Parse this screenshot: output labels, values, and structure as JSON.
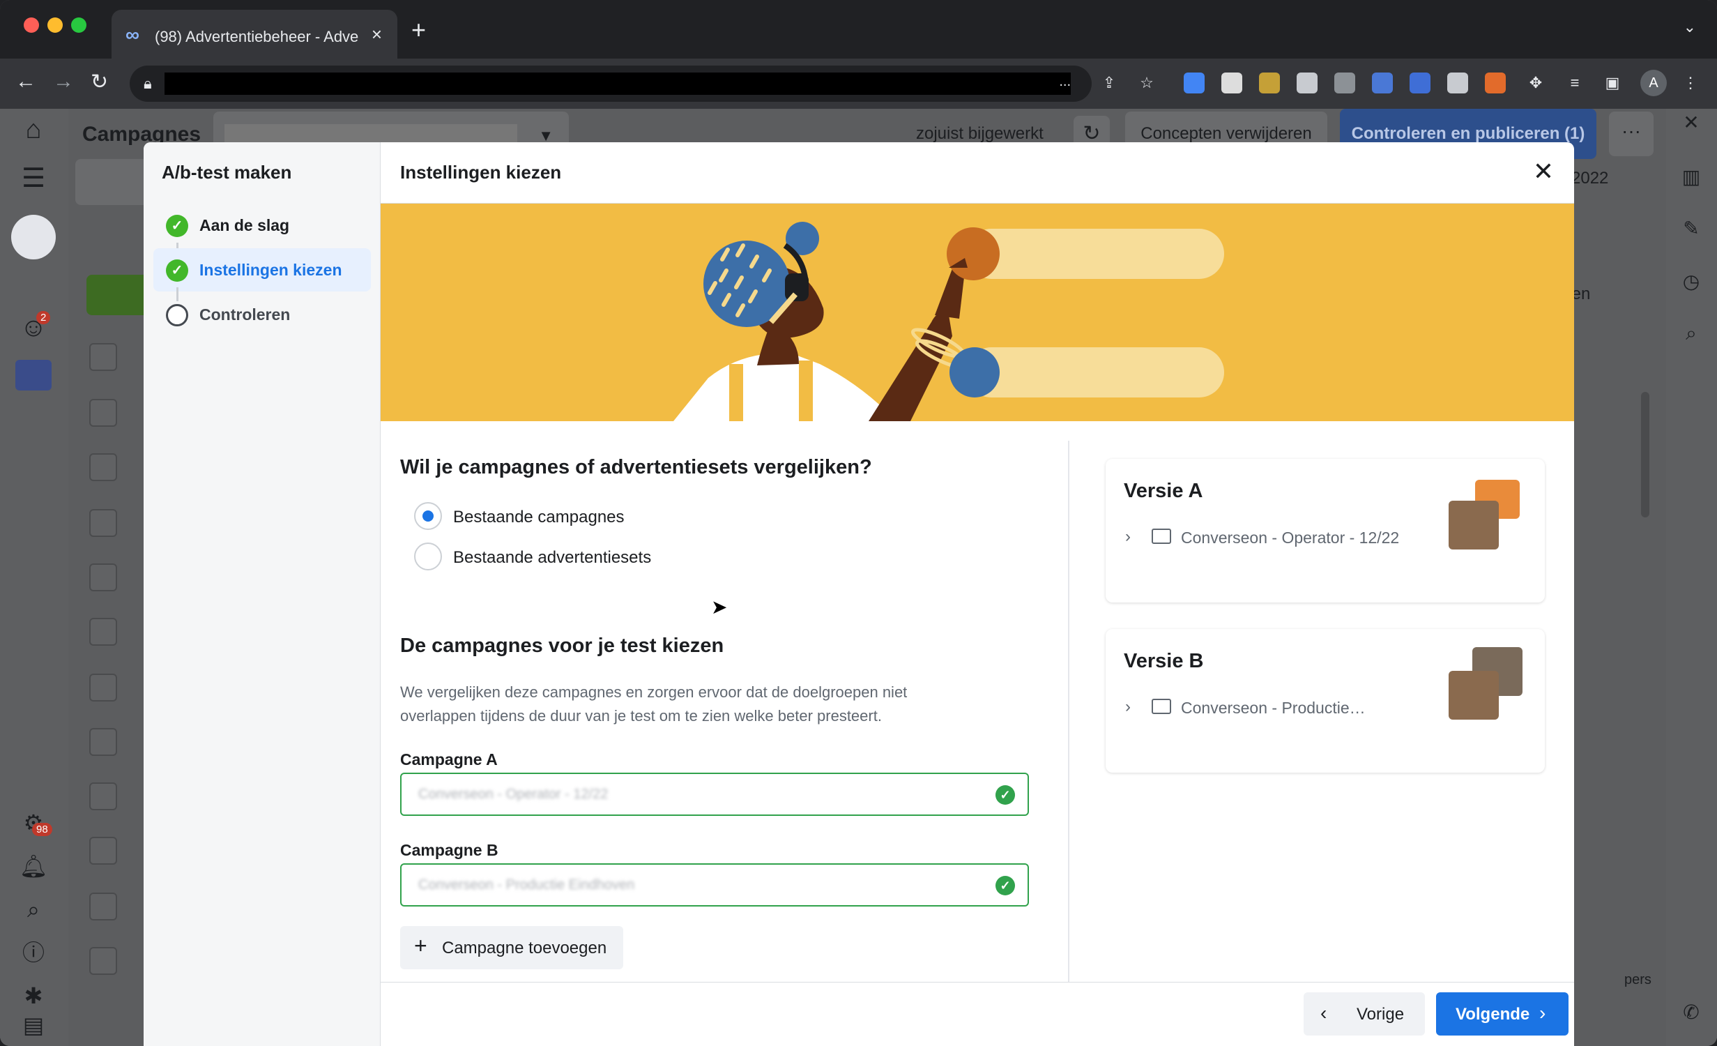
{
  "browser": {
    "tab_title": "(98) Advertentiebeheer - Adve",
    "close_tab": "×",
    "new_tab": "+",
    "url_ellipsis": "...",
    "profile_initial": "A"
  },
  "app": {
    "page_title": "Campagnes",
    "status_text": "zojuist bijgewerkt",
    "delete_drafts": "Concepten verwijderen",
    "review_publish": "Controleren en publiceren (1)",
    "more": "···",
    "year_partial": "2022",
    "export_partial": "rten",
    "columns_partial": "pers",
    "notification_count_1": "2",
    "notification_count_2": "98"
  },
  "modal": {
    "sidebar_title": "A/b-test maken",
    "steps": [
      {
        "label": "Aan de slag",
        "state": "done"
      },
      {
        "label": "Instellingen kiezen",
        "state": "active"
      },
      {
        "label": "Controleren",
        "state": "todo"
      }
    ],
    "title": "Instellingen kiezen",
    "question": "Wil je campagnes of advertentiesets vergelijken?",
    "options": [
      {
        "label": "Bestaande campagnes",
        "selected": true
      },
      {
        "label": "Bestaande advertentiesets",
        "selected": false
      }
    ],
    "section_title": "De campagnes voor je test kiezen",
    "description": "We vergelijken deze campagnes en zorgen ervoor dat de doelgroepen niet overlappen tijdens de duur van je test om te zien welke beter presteert.",
    "campaign_a_label": "Campagne A",
    "campaign_a_value": "Converseon - Operator - 12/22",
    "campaign_b_label": "Campagne B",
    "campaign_b_value": "Converseon - Productie Eindhoven",
    "add_campaign": "Campagne toevoegen",
    "version_a": {
      "title": "Versie A",
      "campaign": "Converseon - Operator - 12/22"
    },
    "version_b": {
      "title": "Versie B",
      "campaign": "Converseon - Productie…"
    },
    "prev": "Vorige",
    "next": "Volgende"
  },
  "colors": {
    "primary": "#1b74e4",
    "success": "#31a24c",
    "banner": "#f2bc44"
  }
}
